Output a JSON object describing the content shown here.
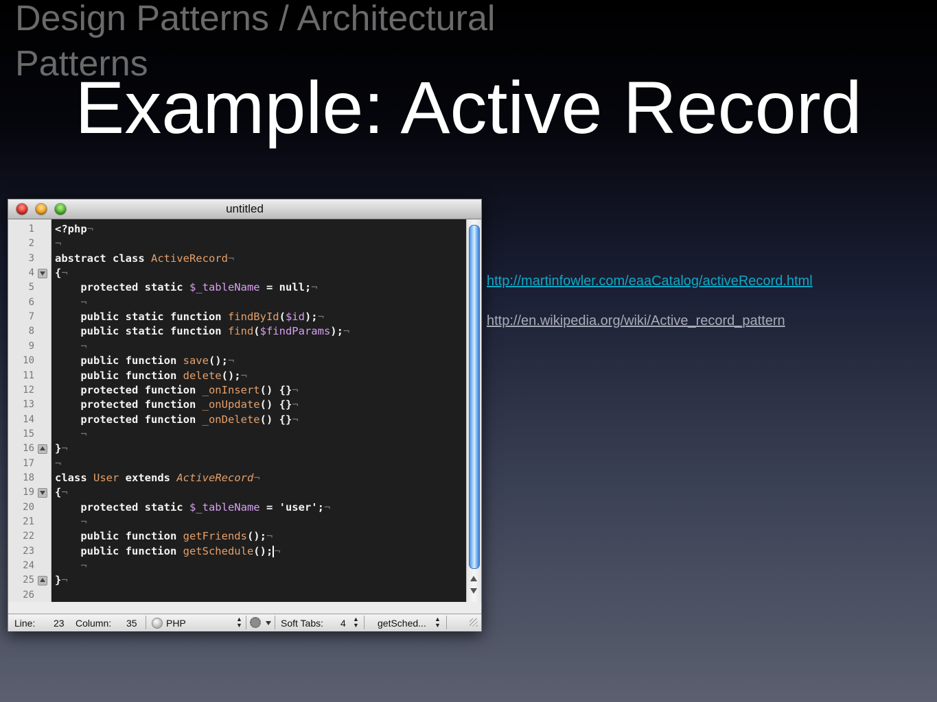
{
  "slide": {
    "supertitle": "Design Patterns / Architectural Patterns",
    "title": "Example: Active Record",
    "links": [
      "http://martinfowler.com/eaaCatalog/activeRecord.html",
      "http://en.wikipedia.org/wiki/Active_record_pattern"
    ]
  },
  "editor": {
    "window_title": "untitled",
    "line_numbers": [
      "1",
      "2",
      "3",
      "4",
      "5",
      "6",
      "7",
      "8",
      "9",
      "10",
      "11",
      "12",
      "13",
      "14",
      "15",
      "16",
      "17",
      "18",
      "19",
      "20",
      "21",
      "22",
      "23",
      "24",
      "25",
      "26"
    ],
    "fold_markers": {
      "4": "down",
      "16": "up",
      "19": "down",
      "25": "up"
    },
    "code_lines": [
      [
        [
          "kw",
          "<?php"
        ],
        [
          "nl",
          "¬"
        ]
      ],
      [
        [
          "nl",
          "¬"
        ]
      ],
      [
        [
          "kw",
          "abstract class "
        ],
        [
          "id",
          "ActiveRecord"
        ],
        [
          "nl",
          "¬"
        ]
      ],
      [
        [
          "kw",
          "{"
        ],
        [
          "nl",
          "¬"
        ]
      ],
      [
        [
          "kw",
          "    protected static "
        ],
        [
          "var",
          "$_tableName"
        ],
        [
          "kw",
          " = null;"
        ],
        [
          "nl",
          "¬"
        ]
      ],
      [
        [
          "nl",
          "    ¬"
        ]
      ],
      [
        [
          "kw",
          "    public static function "
        ],
        [
          "id",
          "findById"
        ],
        [
          "kw",
          "("
        ],
        [
          "var",
          "$id"
        ],
        [
          "kw",
          ");"
        ],
        [
          "nl",
          "¬"
        ]
      ],
      [
        [
          "kw",
          "    public static function "
        ],
        [
          "id",
          "find"
        ],
        [
          "kw",
          "("
        ],
        [
          "var",
          "$findParams"
        ],
        [
          "kw",
          ");"
        ],
        [
          "nl",
          "¬"
        ]
      ],
      [
        [
          "nl",
          "    ¬"
        ]
      ],
      [
        [
          "kw",
          "    public function "
        ],
        [
          "id",
          "save"
        ],
        [
          "kw",
          "();"
        ],
        [
          "nl",
          "¬"
        ]
      ],
      [
        [
          "kw",
          "    public function "
        ],
        [
          "id",
          "delete"
        ],
        [
          "kw",
          "();"
        ],
        [
          "nl",
          "¬"
        ]
      ],
      [
        [
          "kw",
          "    protected function "
        ],
        [
          "id",
          "_onInsert"
        ],
        [
          "kw",
          "() {}"
        ],
        [
          "nl",
          "¬"
        ]
      ],
      [
        [
          "kw",
          "    protected function "
        ],
        [
          "id",
          "_onUpdate"
        ],
        [
          "kw",
          "() {}"
        ],
        [
          "nl",
          "¬"
        ]
      ],
      [
        [
          "kw",
          "    protected function "
        ],
        [
          "id",
          "_onDelete"
        ],
        [
          "kw",
          "() {}"
        ],
        [
          "nl",
          "¬"
        ]
      ],
      [
        [
          "nl",
          "    ¬"
        ]
      ],
      [
        [
          "kw",
          "}"
        ],
        [
          "nl",
          "¬"
        ]
      ],
      [
        [
          "nl",
          "¬"
        ]
      ],
      [
        [
          "kw",
          "class "
        ],
        [
          "id",
          "User"
        ],
        [
          "kw",
          " extends "
        ],
        [
          "it",
          "ActiveRecord"
        ],
        [
          "nl",
          "¬"
        ]
      ],
      [
        [
          "kw",
          "{"
        ],
        [
          "nl",
          "¬"
        ]
      ],
      [
        [
          "kw",
          "    protected static "
        ],
        [
          "var",
          "$_tableName"
        ],
        [
          "kw",
          " = "
        ],
        [
          "str",
          "'user'"
        ],
        [
          "kw",
          ";"
        ],
        [
          "nl",
          "¬"
        ]
      ],
      [
        [
          "nl",
          "    ¬"
        ]
      ],
      [
        [
          "kw",
          "    public function "
        ],
        [
          "id",
          "getFriends"
        ],
        [
          "kw",
          "();"
        ],
        [
          "nl",
          "¬"
        ]
      ],
      [
        [
          "kw",
          "    public function "
        ],
        [
          "id",
          "getSchedule"
        ],
        [
          "kw",
          "();"
        ],
        [
          "cursor",
          ""
        ],
        [
          "nl",
          "¬"
        ]
      ],
      [
        [
          "nl",
          "    ¬"
        ]
      ],
      [
        [
          "kw",
          "}"
        ],
        [
          "nl",
          "¬"
        ]
      ],
      []
    ],
    "status": {
      "line_label": "Line:",
      "line_value": "23",
      "column_label": "Column:",
      "column_value": "35",
      "language": "PHP",
      "tabs_label": "Soft Tabs:",
      "tabs_value": "4",
      "symbol": "getSched..."
    }
  }
}
